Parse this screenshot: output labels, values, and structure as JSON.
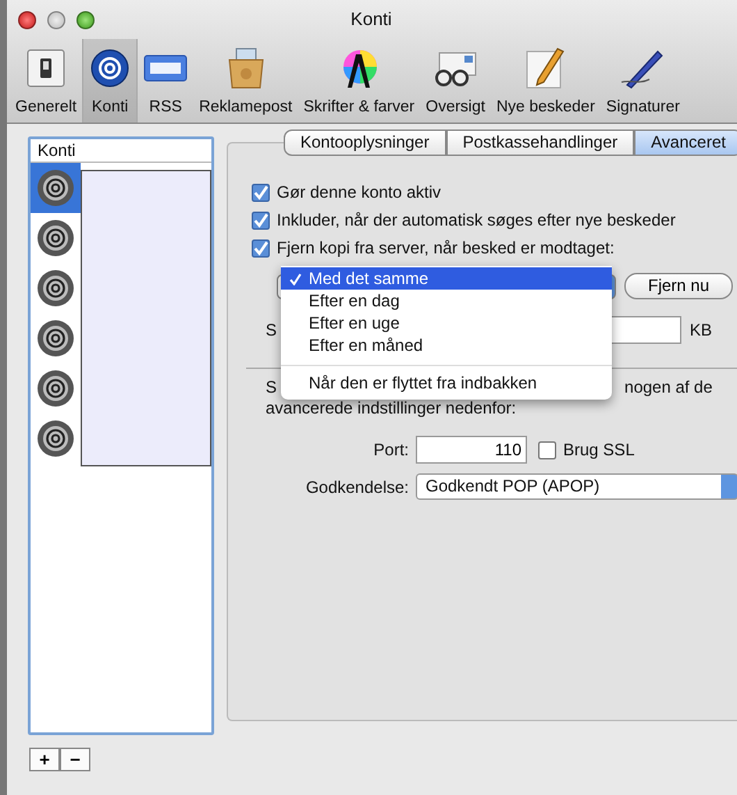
{
  "window": {
    "title": "Konti"
  },
  "toolbar": [
    {
      "label": "Generelt",
      "selected": false
    },
    {
      "label": "Konti",
      "selected": true
    },
    {
      "label": "RSS",
      "selected": false
    },
    {
      "label": "Reklamepost",
      "selected": false
    },
    {
      "label": "Skrifter & farver",
      "selected": false
    },
    {
      "label": "Oversigt",
      "selected": false
    },
    {
      "label": "Nye beskeder",
      "selected": false
    },
    {
      "label": "Signaturer",
      "selected": false
    }
  ],
  "sidebar": {
    "header": "Konti",
    "accounts": [
      {
        "selected": true
      },
      {
        "selected": false
      },
      {
        "selected": false
      },
      {
        "selected": false
      },
      {
        "selected": false
      },
      {
        "selected": false
      }
    ],
    "add_button": "+",
    "remove_button": "−"
  },
  "tabs": [
    {
      "label": "Kontooplysninger",
      "selected": false
    },
    {
      "label": "Postkassehandlinger",
      "selected": false
    },
    {
      "label": "Avanceret",
      "selected": true
    }
  ],
  "checkboxes": [
    {
      "label": "Gør denne konto aktiv",
      "checked": true
    },
    {
      "label": "Inkluder, når der automatisk søges efter nye beskeder",
      "checked": true
    },
    {
      "label": "Fjern kopi fra server, når besked er modtaget:",
      "checked": true
    }
  ],
  "popup_menu": {
    "items": [
      {
        "label": "Med det samme",
        "selected": true,
        "separator_before": false
      },
      {
        "label": "Efter en dag",
        "selected": false,
        "separator_before": false
      },
      {
        "label": "Efter en uge",
        "selected": false,
        "separator_before": false
      },
      {
        "label": "Efter en måned",
        "selected": false,
        "separator_before": false
      },
      {
        "label": "Når den er flyttet fra indbakken",
        "selected": false,
        "separator_before": true
      }
    ]
  },
  "remove_now_button": "Fjern nu",
  "size_row": {
    "label_start": "S",
    "unit": "KB"
  },
  "note": {
    "start": "S",
    "end": "nogen af de",
    "line2": "avancerede indstillinger nedenfor:"
  },
  "port": {
    "label": "Port:",
    "value": "110"
  },
  "ssl": {
    "label": "Brug SSL",
    "checked": false
  },
  "auth": {
    "label": "Godkendelse:",
    "value": "Godkendt POP (APOP)"
  }
}
